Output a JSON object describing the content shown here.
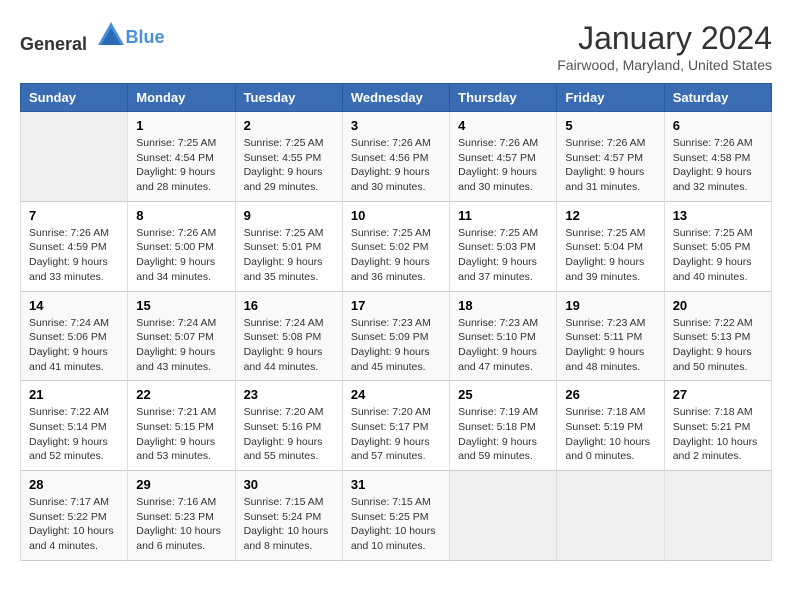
{
  "logo": {
    "text_general": "General",
    "text_blue": "Blue"
  },
  "title": "January 2024",
  "location": "Fairwood, Maryland, United States",
  "days_of_week": [
    "Sunday",
    "Monday",
    "Tuesday",
    "Wednesday",
    "Thursday",
    "Friday",
    "Saturday"
  ],
  "weeks": [
    [
      {
        "day": "",
        "sunrise": "",
        "sunset": "",
        "daylight": "",
        "empty": true
      },
      {
        "day": "1",
        "sunrise": "7:25 AM",
        "sunset": "4:54 PM",
        "daylight": "9 hours and 28 minutes."
      },
      {
        "day": "2",
        "sunrise": "7:25 AM",
        "sunset": "4:55 PM",
        "daylight": "9 hours and 29 minutes."
      },
      {
        "day": "3",
        "sunrise": "7:26 AM",
        "sunset": "4:56 PM",
        "daylight": "9 hours and 30 minutes."
      },
      {
        "day": "4",
        "sunrise": "7:26 AM",
        "sunset": "4:57 PM",
        "daylight": "9 hours and 30 minutes."
      },
      {
        "day": "5",
        "sunrise": "7:26 AM",
        "sunset": "4:57 PM",
        "daylight": "9 hours and 31 minutes."
      },
      {
        "day": "6",
        "sunrise": "7:26 AM",
        "sunset": "4:58 PM",
        "daylight": "9 hours and 32 minutes."
      }
    ],
    [
      {
        "day": "7",
        "sunrise": "7:26 AM",
        "sunset": "4:59 PM",
        "daylight": "9 hours and 33 minutes."
      },
      {
        "day": "8",
        "sunrise": "7:26 AM",
        "sunset": "5:00 PM",
        "daylight": "9 hours and 34 minutes."
      },
      {
        "day": "9",
        "sunrise": "7:25 AM",
        "sunset": "5:01 PM",
        "daylight": "9 hours and 35 minutes."
      },
      {
        "day": "10",
        "sunrise": "7:25 AM",
        "sunset": "5:02 PM",
        "daylight": "9 hours and 36 minutes."
      },
      {
        "day": "11",
        "sunrise": "7:25 AM",
        "sunset": "5:03 PM",
        "daylight": "9 hours and 37 minutes."
      },
      {
        "day": "12",
        "sunrise": "7:25 AM",
        "sunset": "5:04 PM",
        "daylight": "9 hours and 39 minutes."
      },
      {
        "day": "13",
        "sunrise": "7:25 AM",
        "sunset": "5:05 PM",
        "daylight": "9 hours and 40 minutes."
      }
    ],
    [
      {
        "day": "14",
        "sunrise": "7:24 AM",
        "sunset": "5:06 PM",
        "daylight": "9 hours and 41 minutes."
      },
      {
        "day": "15",
        "sunrise": "7:24 AM",
        "sunset": "5:07 PM",
        "daylight": "9 hours and 43 minutes."
      },
      {
        "day": "16",
        "sunrise": "7:24 AM",
        "sunset": "5:08 PM",
        "daylight": "9 hours and 44 minutes."
      },
      {
        "day": "17",
        "sunrise": "7:23 AM",
        "sunset": "5:09 PM",
        "daylight": "9 hours and 45 minutes."
      },
      {
        "day": "18",
        "sunrise": "7:23 AM",
        "sunset": "5:10 PM",
        "daylight": "9 hours and 47 minutes."
      },
      {
        "day": "19",
        "sunrise": "7:23 AM",
        "sunset": "5:11 PM",
        "daylight": "9 hours and 48 minutes."
      },
      {
        "day": "20",
        "sunrise": "7:22 AM",
        "sunset": "5:13 PM",
        "daylight": "9 hours and 50 minutes."
      }
    ],
    [
      {
        "day": "21",
        "sunrise": "7:22 AM",
        "sunset": "5:14 PM",
        "daylight": "9 hours and 52 minutes."
      },
      {
        "day": "22",
        "sunrise": "7:21 AM",
        "sunset": "5:15 PM",
        "daylight": "9 hours and 53 minutes."
      },
      {
        "day": "23",
        "sunrise": "7:20 AM",
        "sunset": "5:16 PM",
        "daylight": "9 hours and 55 minutes."
      },
      {
        "day": "24",
        "sunrise": "7:20 AM",
        "sunset": "5:17 PM",
        "daylight": "9 hours and 57 minutes."
      },
      {
        "day": "25",
        "sunrise": "7:19 AM",
        "sunset": "5:18 PM",
        "daylight": "9 hours and 59 minutes."
      },
      {
        "day": "26",
        "sunrise": "7:18 AM",
        "sunset": "5:19 PM",
        "daylight": "10 hours and 0 minutes."
      },
      {
        "day": "27",
        "sunrise": "7:18 AM",
        "sunset": "5:21 PM",
        "daylight": "10 hours and 2 minutes."
      }
    ],
    [
      {
        "day": "28",
        "sunrise": "7:17 AM",
        "sunset": "5:22 PM",
        "daylight": "10 hours and 4 minutes."
      },
      {
        "day": "29",
        "sunrise": "7:16 AM",
        "sunset": "5:23 PM",
        "daylight": "10 hours and 6 minutes."
      },
      {
        "day": "30",
        "sunrise": "7:15 AM",
        "sunset": "5:24 PM",
        "daylight": "10 hours and 8 minutes."
      },
      {
        "day": "31",
        "sunrise": "7:15 AM",
        "sunset": "5:25 PM",
        "daylight": "10 hours and 10 minutes."
      },
      {
        "day": "",
        "sunrise": "",
        "sunset": "",
        "daylight": "",
        "empty": true
      },
      {
        "day": "",
        "sunrise": "",
        "sunset": "",
        "daylight": "",
        "empty": true
      },
      {
        "day": "",
        "sunrise": "",
        "sunset": "",
        "daylight": "",
        "empty": true
      }
    ]
  ]
}
